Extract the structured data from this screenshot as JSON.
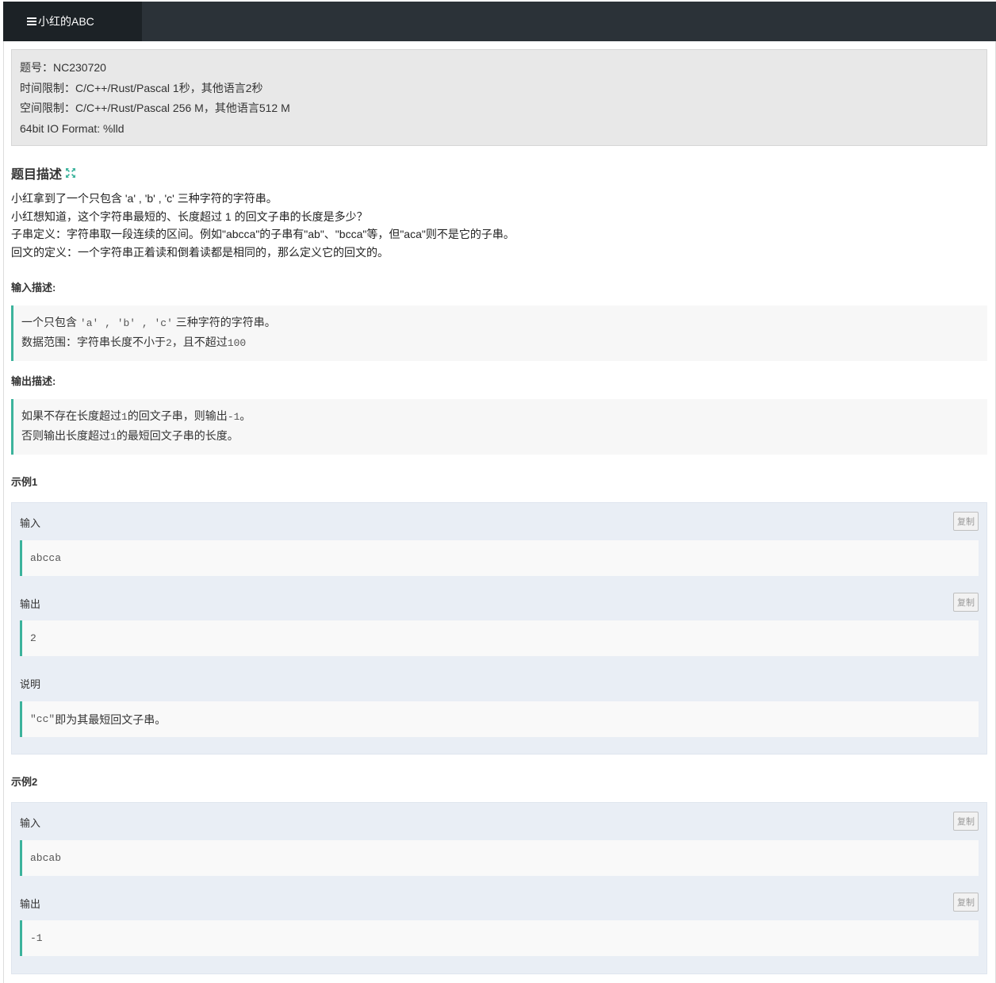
{
  "tab": {
    "title": "小红的ABC",
    "icon": "list-icon"
  },
  "info": {
    "line1": "题号：NC230720",
    "line2": "时间限制：C/C++/Rust/Pascal 1秒，其他语言2秒",
    "line3": "空间限制：C/C++/Rust/Pascal 256 M，其他语言512 M",
    "line4": "64bit IO Format: %lld"
  },
  "description": {
    "title": "题目描述",
    "lines": [
      "小红拿到了一个只包含 'a' , 'b' , 'c' 三种字符的字符串。",
      "小红想知道，这个字符串最短的、长度超过 1 的回文子串的长度是多少？",
      "子串定义：字符串取一段连续的区间。例如\"abcca\"的子串有\"ab\"、\"bcca\"等，但\"aca\"则不是它的子串。",
      "回文的定义：一个字符串正着读和倒着读都是相同的，那么定义它的回文的。"
    ]
  },
  "input_desc": {
    "title": "输入描述:",
    "line1_pre": "一个只包含 ",
    "line1_code": "'a' , 'b' , 'c'",
    "line1_post": " 三种字符的字符串。",
    "line2_pre": "数据范围：字符串长度不小于",
    "line2_code1": "2",
    "line2_mid": "，且不超过",
    "line2_code2": "100"
  },
  "output_desc": {
    "title": "输出描述:",
    "line1_pre": "如果不存在长度超过",
    "line1_code1": "1",
    "line1_mid": "的回文子串，则输出",
    "line1_code2": "-1",
    "line1_post": "。",
    "line2_pre": "否则输出长度超过",
    "line2_code": "1",
    "line2_post": "的最短回文子串的长度。"
  },
  "examples": [
    {
      "title": "示例1",
      "input_label": "输入",
      "input_value": "abcca",
      "output_label": "输出",
      "output_value": "2",
      "note_label": "说明",
      "note_code": "\"cc\"",
      "note_text": "即为其最短回文子串。",
      "copy_label": "复制"
    },
    {
      "title": "示例2",
      "input_label": "输入",
      "input_value": "abcab",
      "output_label": "输出",
      "output_value": "-1",
      "copy_label": "复制"
    }
  ],
  "colors": {
    "topbar": "#2b3238",
    "accent": "#3cb39c",
    "info_bg": "#e8e8e8",
    "example_bg": "#e9eef5"
  }
}
